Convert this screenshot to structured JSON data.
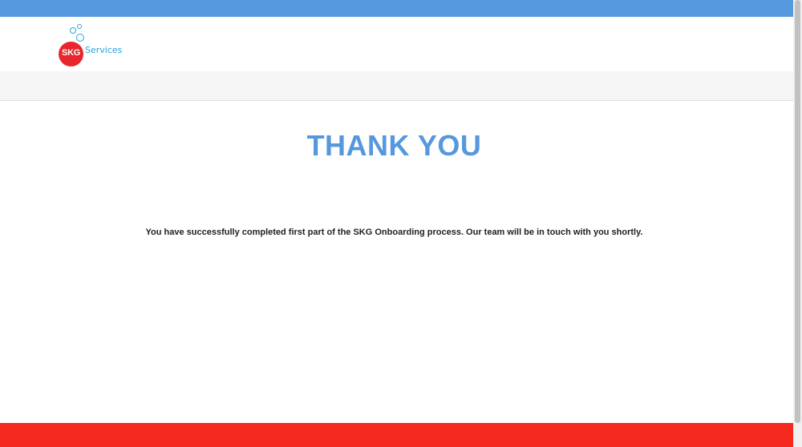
{
  "header": {
    "logo": {
      "mark_text": "SKG",
      "wordmark_text": "Services",
      "icon": "bubbles-logo-icon"
    }
  },
  "main": {
    "title": "THANK YOU",
    "message": "You have successfully completed first part of the SKG Onboarding process. Our team will be in touch with you shortly."
  },
  "colors": {
    "top_bar": "#5598dd",
    "title": "#5598dd",
    "logo_red": "#e8262b",
    "logo_blue": "#2aa3d8",
    "footer_bar": "#f4281f",
    "grey_band": "#f5f5f5"
  }
}
